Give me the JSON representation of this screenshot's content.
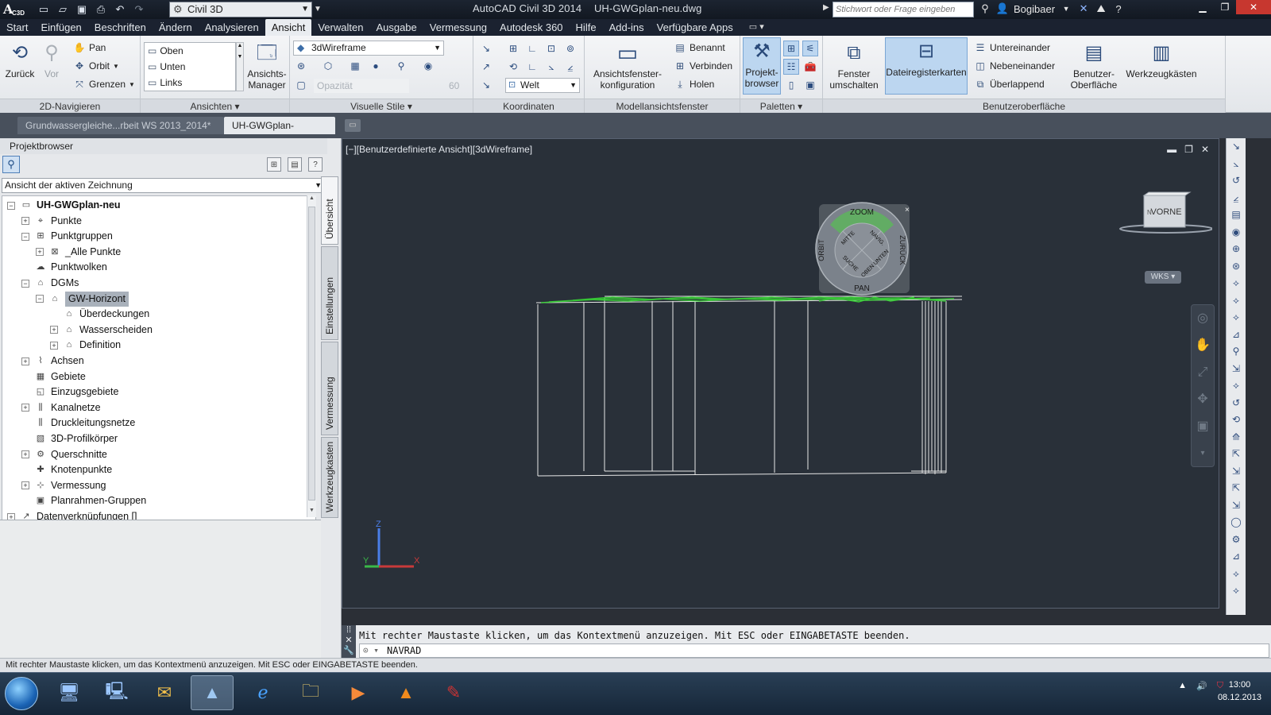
{
  "titlebar": {
    "workspace": "Civil 3D",
    "app_title": "AutoCAD Civil 3D 2014",
    "file_name": "UH-GWGplan-neu.dwg",
    "search_placeholder": "Stichwort oder Frage eingeben",
    "user": "Bogibaer"
  },
  "ribbon_tabs": [
    "Start",
    "Einfügen",
    "Beschriften",
    "Ändern",
    "Analysieren",
    "Ansicht",
    "Verwalten",
    "Ausgabe",
    "Vermessung",
    "Autodesk 360",
    "Hilfe",
    "Add-ins",
    "Verfügbare Apps"
  ],
  "active_ribbon_tab": "Ansicht",
  "ribbon": {
    "nav2d": {
      "title": "2D-Navigieren",
      "back": "Zurück",
      "forward": "Vor",
      "pan": "Pan",
      "orbit": "Orbit",
      "extents": "Grenzen"
    },
    "views": {
      "title": "Ansichten",
      "items": [
        "Oben",
        "Unten",
        "Links"
      ],
      "manager": "Ansichts-\nManager"
    },
    "visual_styles": {
      "title": "Visuelle Stile",
      "style": "3dWireframe",
      "opacity_label": "Opazität",
      "opacity_value": "60"
    },
    "coordinates": {
      "title": "Koordinaten",
      "ucs": "Welt"
    },
    "model_viewports": {
      "title": "Modellansichtsfenster",
      "config": "Ansichtsfenster-\nkonfiguration",
      "named": "Benannt",
      "join": "Verbinden",
      "restore": "Holen"
    },
    "palettes": {
      "title": "Paletten",
      "project_browser": "Projekt-\nbrowser"
    },
    "user_interface": {
      "title": "Benutzeroberfläche",
      "switch_windows": "Fenster\numschalten",
      "file_tabs": "Dateiregisterkarten",
      "tile_h": "Untereinander",
      "tile_v": "Nebeneinander",
      "cascade": "Überlappend",
      "ui": "Benutzer-\nOberfläche",
      "toolbars": "Werkzeugkästen"
    }
  },
  "doc_tabs": [
    {
      "label": "Grundwassergleiche...rbeit WS 2013_2014*",
      "active": false
    },
    {
      "label": "UH-GWGplan-neu*",
      "active": true
    }
  ],
  "project_browser": {
    "title": "Projektbrowser",
    "view_mode": "Ansicht der aktiven Zeichnung",
    "tree": [
      {
        "label": "UH-GWGplan-neu",
        "level": 0,
        "exp": "−",
        "icon": "drawing-icon",
        "glyph": "▭",
        "bold": true
      },
      {
        "label": "Punkte",
        "level": 1,
        "exp": "+",
        "icon": "point-icon",
        "glyph": "⌖"
      },
      {
        "label": "Punktgruppen",
        "level": 1,
        "exp": "−",
        "icon": "point-group-icon",
        "glyph": "⊞"
      },
      {
        "label": "_Alle Punkte",
        "level": 2,
        "exp": "+",
        "icon": "all-points-icon",
        "glyph": "⊠"
      },
      {
        "label": "Punktwolken",
        "level": 1,
        "exp": "",
        "icon": "point-cloud-icon",
        "glyph": "☁"
      },
      {
        "label": "DGMs",
        "level": 1,
        "exp": "−",
        "icon": "surface-icon",
        "glyph": "⌂"
      },
      {
        "label": "GW-Horizont",
        "level": 2,
        "exp": "−",
        "icon": "surface-icon",
        "glyph": "⌂",
        "selected": true
      },
      {
        "label": "Überdeckungen",
        "level": 3,
        "exp": "",
        "icon": "mask-icon",
        "glyph": "⌂"
      },
      {
        "label": "Wasserscheiden",
        "level": 3,
        "exp": "+",
        "icon": "watershed-icon",
        "glyph": "⌂"
      },
      {
        "label": "Definition",
        "level": 3,
        "exp": "+",
        "icon": "definition-icon",
        "glyph": "⌂"
      },
      {
        "label": "Achsen",
        "level": 1,
        "exp": "+",
        "icon": "alignment-icon",
        "glyph": "⌇"
      },
      {
        "label": "Gebiete",
        "level": 1,
        "exp": "",
        "icon": "site-icon",
        "glyph": "▦"
      },
      {
        "label": "Einzugsgebiete",
        "level": 1,
        "exp": "",
        "icon": "catchment-icon",
        "glyph": "◱"
      },
      {
        "label": "Kanalnetze",
        "level": 1,
        "exp": "+",
        "icon": "pipe-network-icon",
        "glyph": "⫼"
      },
      {
        "label": "Druckleitungsnetze",
        "level": 1,
        "exp": "",
        "icon": "pressure-network-icon",
        "glyph": "⫼"
      },
      {
        "label": "3D-Profilkörper",
        "level": 1,
        "exp": "",
        "icon": "corridor-icon",
        "glyph": "▧"
      },
      {
        "label": "Querschnitte",
        "level": 1,
        "exp": "+",
        "icon": "assembly-icon",
        "glyph": "⚙"
      },
      {
        "label": "Knotenpunkte",
        "level": 1,
        "exp": "",
        "icon": "intersection-icon",
        "glyph": "✚"
      },
      {
        "label": "Vermessung",
        "level": 1,
        "exp": "+",
        "icon": "survey-icon",
        "glyph": "⊹"
      },
      {
        "label": "Planrahmen-Gruppen",
        "level": 1,
        "exp": "",
        "icon": "view-frame-icon",
        "glyph": "▣"
      },
      {
        "label": "Datenverknüpfungen []",
        "level": 0,
        "exp": "+",
        "icon": "data-shortcut-icon",
        "glyph": "↗"
      }
    ],
    "side_tabs": [
      "Übersicht",
      "Einstellungen",
      "Vermessung",
      "Werkzeugkasten"
    ]
  },
  "viewport": {
    "label": "[−][Benutzerdefinierte Ansicht][3dWireframe]",
    "navwheel": {
      "top": "ZOOM",
      "bottom": "PAN",
      "left": "ORBIT",
      "right": "ZURÜCK",
      "center": [
        "MITTE",
        "NAVIG.",
        "SUCHE",
        "OBEN UNTEN"
      ]
    },
    "viewcube_face": "VORNE",
    "wcs": "WKS",
    "axes": {
      "x": "X",
      "y": "Y",
      "z": "Z"
    }
  },
  "command": {
    "history": "Mit rechter Maustaste klicken, um das Kontextmenü anzuzeigen. Mit ESC oder EINGABETASTE beenden.",
    "current": "NAVRAD"
  },
  "status_bar": "Mit rechter Maustaste klicken, um das Kontextmenü anzuzeigen. Mit ESC oder EINGABETASTE beenden.",
  "taskbar": {
    "time": "13:00",
    "date": "08.12.2013"
  },
  "colors": {
    "viewport_bg": "#293039",
    "surface_green": "#39d636",
    "selection": "#a9b1bb"
  }
}
